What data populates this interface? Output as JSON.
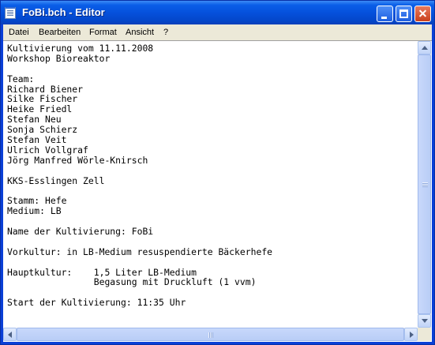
{
  "window": {
    "title": "FoBi.bch - Editor"
  },
  "menubar": {
    "items": [
      "Datei",
      "Bearbeiten",
      "Format",
      "Ansicht",
      "?"
    ]
  },
  "document": {
    "lines": [
      "Kultivierung vom 11.11.2008",
      "Workshop Bioreaktor",
      "",
      "Team:",
      "Richard Biener",
      "Silke Fischer",
      "Heike Friedl",
      "Stefan Neu",
      "Sonja Schierz",
      "Stefan Veit",
      "Ulrich Vollgraf",
      "Jörg Manfred Wörle-Knirsch",
      "",
      "KKS-Esslingen Zell",
      "",
      "Stamm: Hefe",
      "Medium: LB",
      "",
      "Name der Kultivierung: FoBi",
      "",
      "Vorkultur: in LB-Medium resuspendierte Bäckerhefe",
      "",
      "Hauptkultur:    1,5 Liter LB-Medium",
      "                Begasung mit Druckluft (1 vvm)",
      "",
      "Start der Kultivierung: 11:35 Uhr"
    ]
  },
  "theme": {
    "titlebar_color": "#0551dc",
    "menubar_color": "#ece9d8",
    "close_button_color": "#c9401c"
  }
}
